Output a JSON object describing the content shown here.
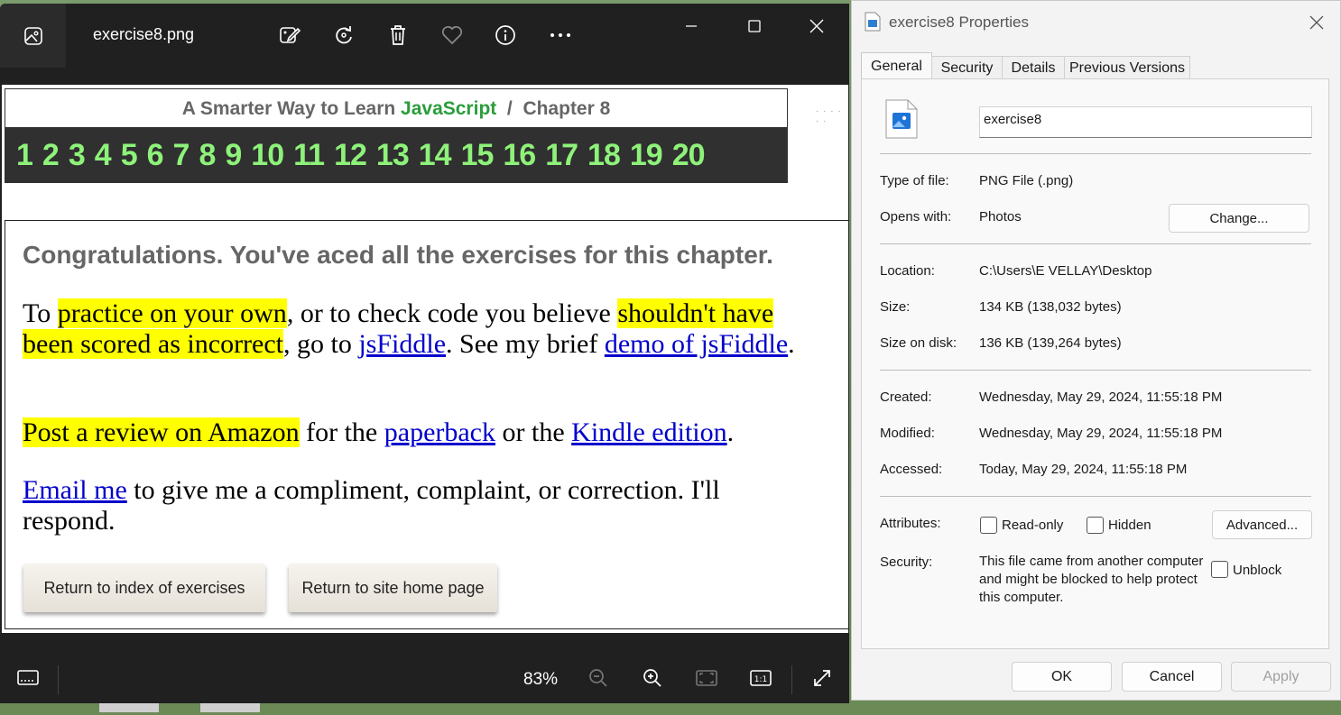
{
  "viewer": {
    "filename": "exercise8.png",
    "icons": [
      "edit-image-icon",
      "rotate-icon",
      "delete-icon",
      "favorite-heart-icon",
      "info-icon",
      "more-options-icon"
    ],
    "zoom": "83%"
  },
  "page": {
    "header_title_prefix": "A Smarter Way to Learn ",
    "header_title_js": "JavaScript",
    "header_title_suffix": "  /  Chapter 8",
    "chapter_numbers": [
      "1",
      "2",
      "3",
      "4",
      "5",
      "6",
      "7",
      "8",
      "9",
      "10",
      "11",
      "12",
      "13",
      "14",
      "15",
      "16",
      "17",
      "18",
      "19",
      "20"
    ],
    "congrats": "Congratulations. You've aced all the exercises for this chapter.",
    "p1": {
      "t1": "To ",
      "h1": "practice on your own",
      "t2": ", or to check code you believe ",
      "h2": "shouldn't have been scored as incorrect",
      "t3": ", go to ",
      "l1": "jsFiddle",
      "t4": ". See my brief ",
      "l2": "demo of jsFiddle",
      "t5": "."
    },
    "p2": {
      "h1": "Post a review on Amazon",
      "t1": " for the ",
      "l1": "paperback",
      "t2": " or the ",
      "l2": "Kindle edition",
      "t3": "."
    },
    "p3": {
      "l1": "Email me",
      "t1": " to give me a compliment, complaint, or correction. I'll respond."
    },
    "btn_index": "Return to index of exercises",
    "btn_home": "Return to site home page"
  },
  "props": {
    "title": "exercise8 Properties",
    "tabs": [
      "General",
      "Security",
      "Details",
      "Previous Versions"
    ],
    "name": "exercise8",
    "type_label": "Type of file:",
    "type_value": "PNG File (.png)",
    "opens_label": "Opens with:",
    "opens_value": "Photos",
    "change_btn": "Change...",
    "location_label": "Location:",
    "location_value": "C:\\Users\\E VELLAY\\Desktop",
    "size_label": "Size:",
    "size_value": "134 KB (138,032 bytes)",
    "sizedisk_label": "Size on disk:",
    "sizedisk_value": "136 KB (139,264 bytes)",
    "created_label": "Created:",
    "created_value": "Wednesday, May 29, 2024, 11:55:18 PM",
    "modified_label": "Modified:",
    "modified_value": "Wednesday, May 29, 2024, 11:55:18 PM",
    "accessed_label": "Accessed:",
    "accessed_value": "Today, May 29, 2024, 11:55:18 PM",
    "attributes_label": "Attributes:",
    "readonly_label": "Read-only",
    "hidden_label": "Hidden",
    "advanced_btn": "Advanced...",
    "security_label": "Security:",
    "security_text": "This file came from another computer and might be blocked to help protect this computer.",
    "unblock_label": "Unblock",
    "ok_btn": "OK",
    "cancel_btn": "Cancel",
    "apply_btn": "Apply"
  }
}
